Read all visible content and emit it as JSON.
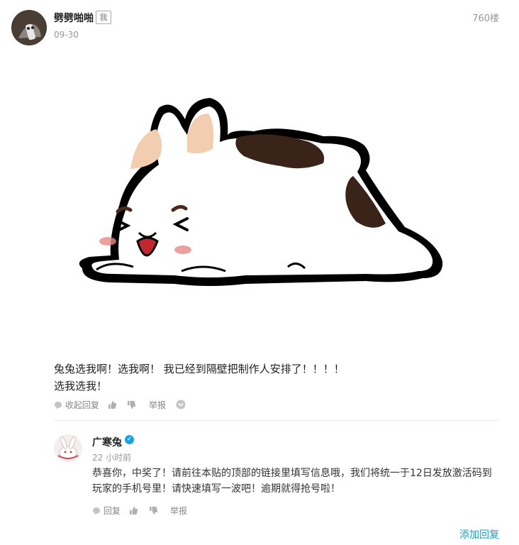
{
  "post": {
    "username": "劈劈啪啪",
    "me_badge": "我",
    "date": "09-30",
    "floor": "760楼",
    "text_line1": "兔兔选我啊！选我啊！ 我已经到隔壁把制作人安排了！！！！",
    "text_line2": "选我选我！",
    "actions": {
      "collapse_reply": "收起回复",
      "report": "举报"
    }
  },
  "reply": {
    "username": "广寒兔",
    "verified_mark": "✓",
    "time": "22 小时前",
    "text_line1": "恭喜你，中奖了！请前往本贴的顶部的链接里填写信息哦，我们将统一于12日发放激活码到",
    "text_line2": "玩家的手机号里！请快速填写一波吧！逾期就得抢号啦！",
    "actions": {
      "reply": "回复",
      "report": "举报"
    }
  },
  "add_reply": "添加回复",
  "colors": {
    "accent_link": "#19a1c4",
    "verified_blue": "#1aa3e0",
    "muted_text": "#999999"
  }
}
